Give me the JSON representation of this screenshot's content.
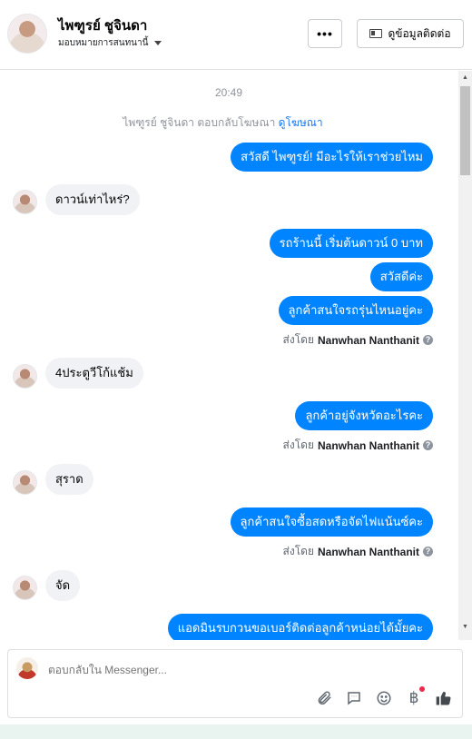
{
  "header": {
    "name": "ไพฑูรย์ ชูจินดา",
    "assign_label": "มอบหมายการสนทนานี้",
    "more_label": "•••",
    "contact_label": "ดูข้อมูลติดต่อ"
  },
  "chat": {
    "timestamp": "20:49",
    "replied_text": "ไพฑูรย์ ชูจินดา ตอบกลับโฆษณา",
    "replied_link": "ดูโฆษณา",
    "sent_by_prefix": "ส่งโดย",
    "sent_by_name": "Nanwhan Nanthanit",
    "messages": [
      {
        "side": "out",
        "text": "สวัสดี ไพฑูรย์! มีอะไรให้เราช่วยไหม"
      },
      {
        "side": "in",
        "text": "ดาวน์เท่าไหร่?"
      },
      {
        "side": "out",
        "text": "รถร้านนี้ เริ่มต้นดาวน์ 0 บาท"
      },
      {
        "side": "out",
        "text": "สวัสดีค่ะ"
      },
      {
        "side": "out",
        "text": "ลูกค้าสนใจรถรุ่นไหนอยู่คะ"
      },
      {
        "side": "in",
        "text": "4ประตูวีโก้แช้ม"
      },
      {
        "side": "out",
        "text": "ลูกค้าอยู่จังหวัดอะไรคะ"
      },
      {
        "side": "in",
        "text": "สุราด"
      },
      {
        "side": "out",
        "text": "ลูกค้าสนใจซื้อสดหรือจัดไฟแน้นซ์คะ"
      },
      {
        "side": "in",
        "text": "จัด"
      },
      {
        "side": "out",
        "text": "แอดมินรบกวนขอเบอร์ติดต่อลูกค้าหน่อยได้มั้ยคะ"
      }
    ]
  },
  "composer": {
    "placeholder": "ตอบกลับใน Messenger...",
    "icons": [
      "paperclip-icon",
      "saved-reply-icon",
      "emoji-icon",
      "baht-payment-icon",
      "thumbs-up-icon"
    ]
  },
  "colors": {
    "outgoing": "#0084ff",
    "incoming": "#f0f2f5",
    "link": "#1877f2"
  }
}
